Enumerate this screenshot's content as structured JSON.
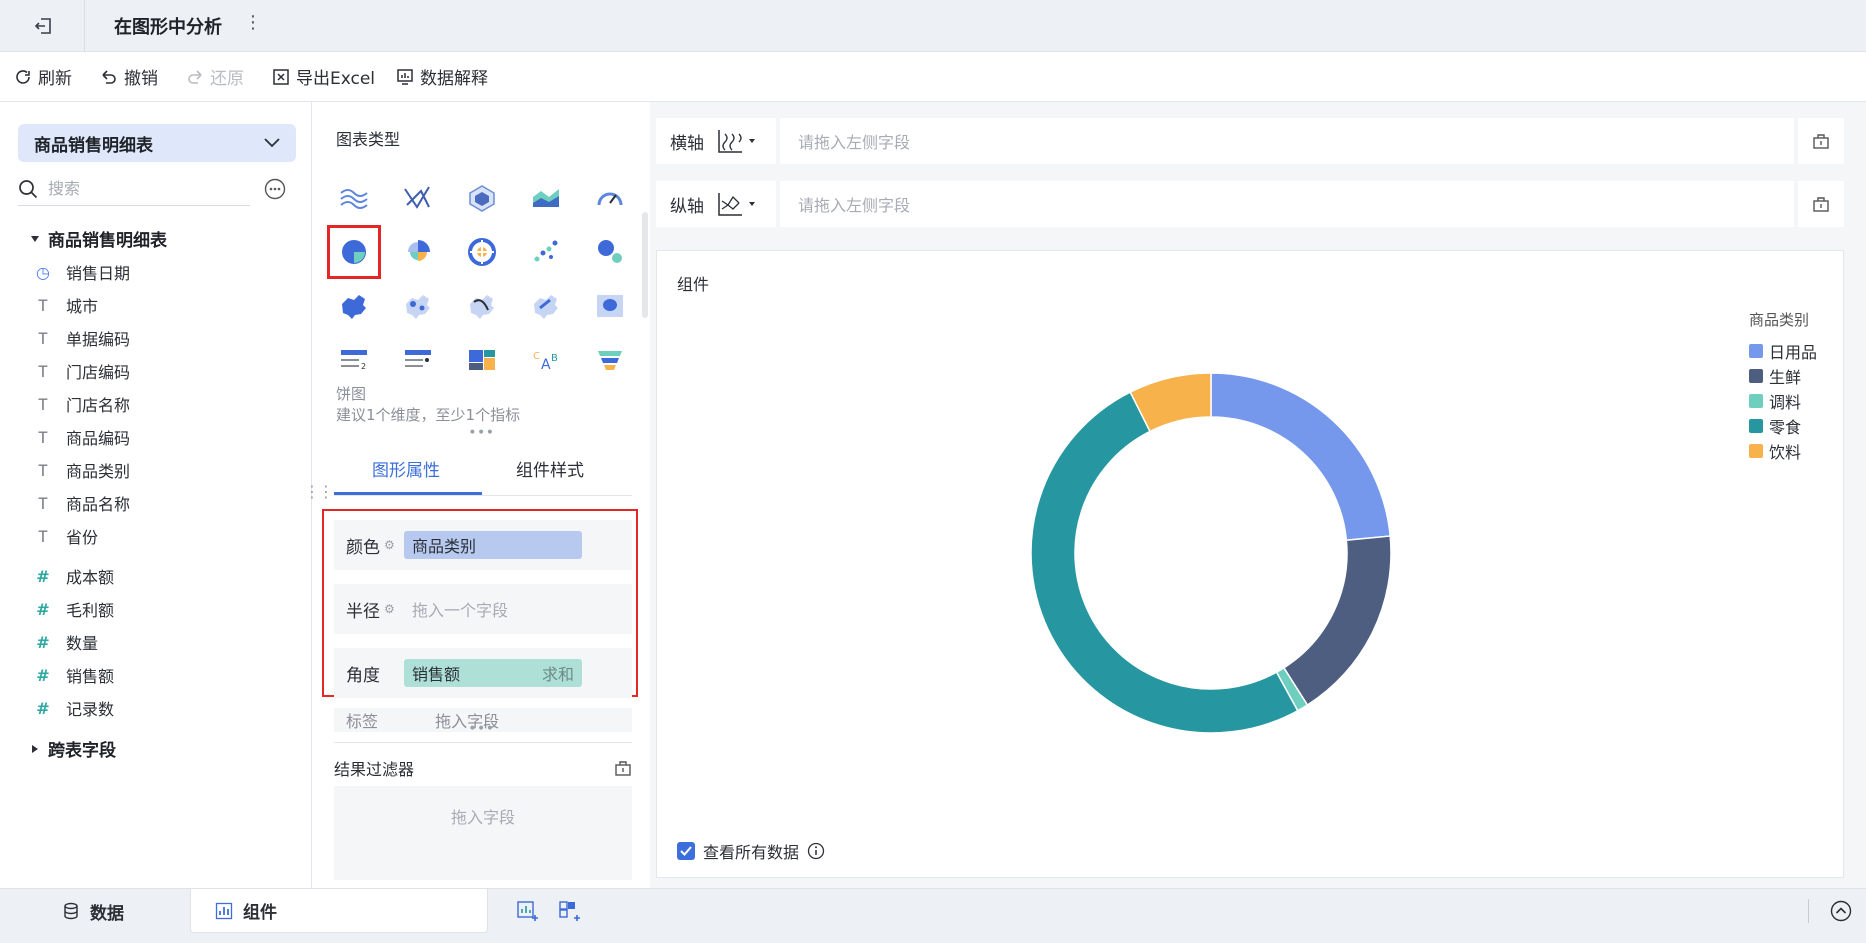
{
  "titlebar": {
    "title": "在图形中分析"
  },
  "toolbar": {
    "refresh": "刷新",
    "undo": "撤销",
    "redo": "还原",
    "export": "导出Excel",
    "explain": "数据解释"
  },
  "left": {
    "dataset": "商品销售明细表",
    "search_placeholder": "搜索",
    "group": "商品销售明细表",
    "dimensions": [
      {
        "label": "销售日期",
        "icon": "clock-icon"
      },
      {
        "label": "城市",
        "icon": "text-type-icon"
      },
      {
        "label": "单据编码",
        "icon": "text-type-icon"
      },
      {
        "label": "门店编码",
        "icon": "text-type-icon"
      },
      {
        "label": "门店名称",
        "icon": "text-type-icon"
      },
      {
        "label": "商品编码",
        "icon": "text-type-icon"
      },
      {
        "label": "商品类别",
        "icon": "text-type-icon"
      },
      {
        "label": "商品名称",
        "icon": "text-type-icon"
      },
      {
        "label": "省份",
        "icon": "text-type-icon"
      }
    ],
    "measures": [
      {
        "label": "成本额"
      },
      {
        "label": "毛利额"
      },
      {
        "label": "数量"
      },
      {
        "label": "销售额"
      },
      {
        "label": "记录数"
      }
    ],
    "cross": "跨表字段"
  },
  "middle": {
    "chart_type_title": "图表类型",
    "chart_name": "饼图",
    "chart_hint": "建议1个维度，至少1个指标",
    "tabs": {
      "properties": "图形属性",
      "style": "组件样式"
    },
    "props": {
      "color_label": "颜色",
      "color_value": "商品类别",
      "radius_label": "半径",
      "radius_placeholder": "拖入一个字段",
      "angle_label": "角度",
      "angle_value": "销售额",
      "angle_agg": "求和",
      "label_label": "标签",
      "label_placeholder": "拖入字段"
    },
    "filter_title": "结果过滤器",
    "filter_placeholder": "拖入字段"
  },
  "right": {
    "x_label": "横轴",
    "x_placeholder": "请拖入左侧字段",
    "y_label": "纵轴",
    "y_placeholder": "请拖入左侧字段",
    "component_title": "组件",
    "view_all": "查看所有数据"
  },
  "chart_data": {
    "type": "pie",
    "legend_title": "商品类别",
    "categories": [
      "日用品",
      "生鲜",
      "调料",
      "零食",
      "饮料"
    ],
    "values": [
      23.5,
      17.5,
      1.0,
      50.6,
      7.4
    ],
    "colors": [
      "#7598ec",
      "#4d5e80",
      "#6fcfbe",
      "#2697a1",
      "#f8b24c"
    ],
    "legend_placement": "top-right"
  },
  "bottombar": {
    "data_tab": "数据",
    "component_tab": "组件"
  }
}
